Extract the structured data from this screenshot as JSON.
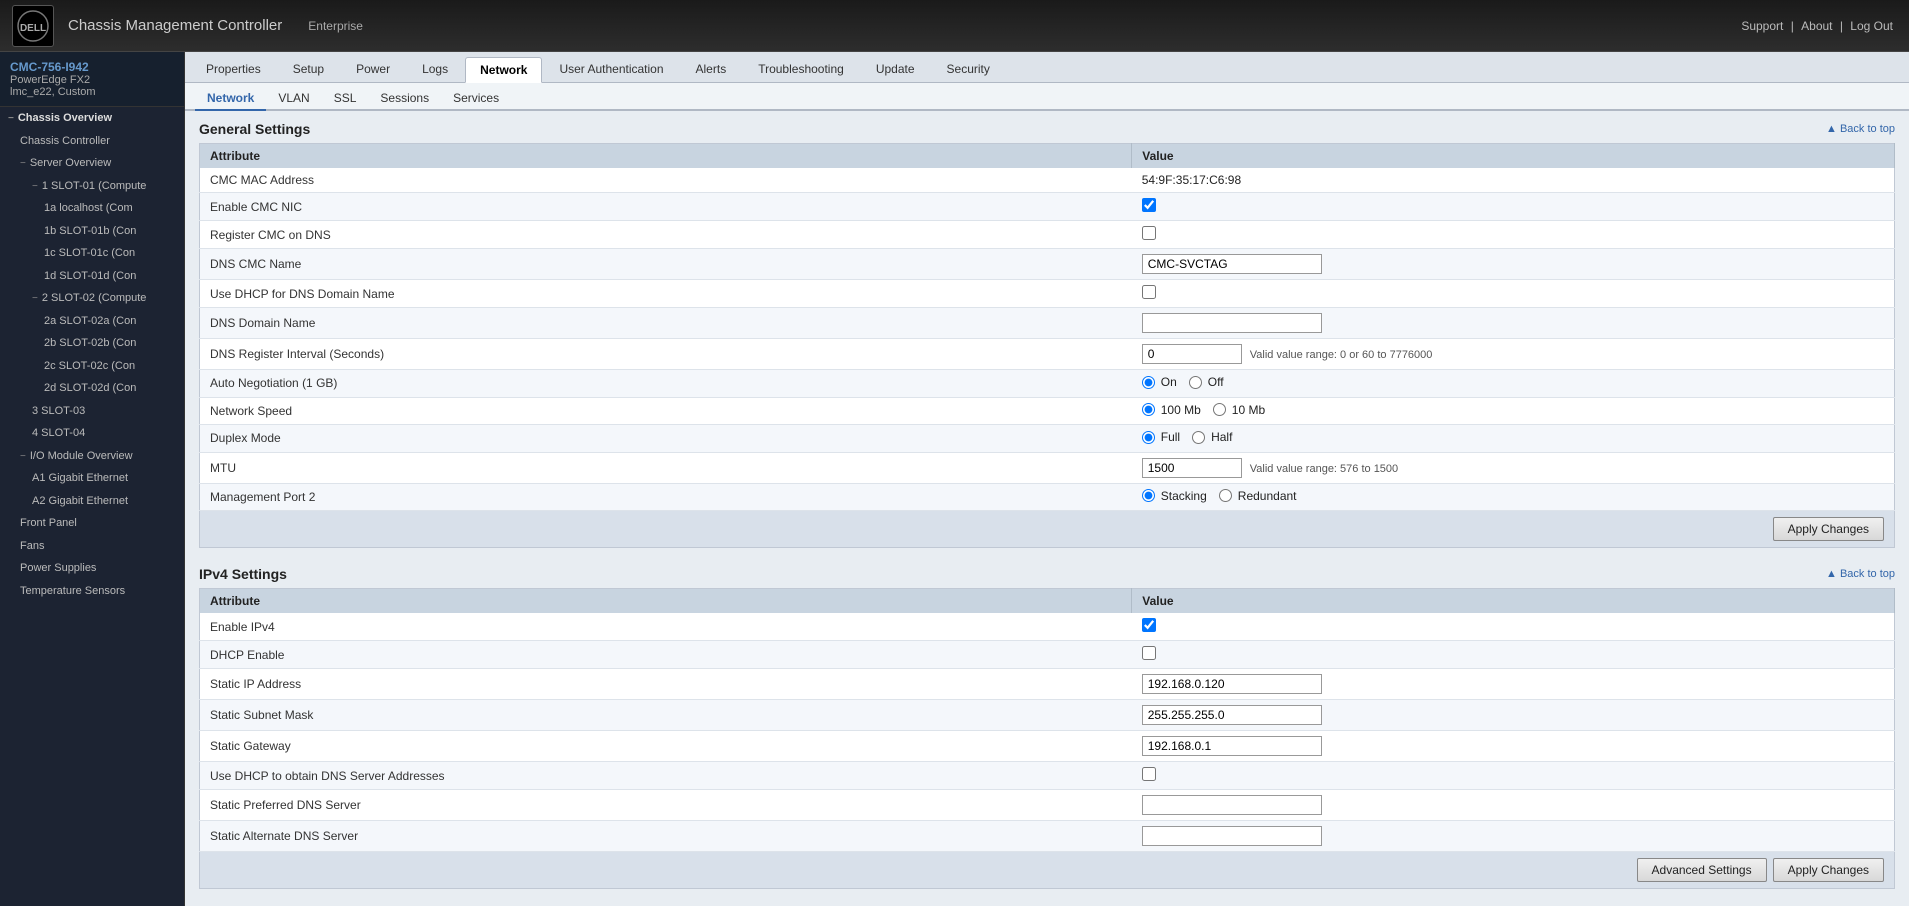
{
  "header": {
    "logo_text": "DELL",
    "title": "Chassis Management Controller",
    "badge": "Enterprise",
    "nav_support": "Support",
    "nav_about": "About",
    "nav_logout": "Log Out"
  },
  "sidebar": {
    "device_name": "CMC-756-I942",
    "device_model": "PowerEdge FX2",
    "device_custom": "lmc_e22, Custom",
    "items": [
      {
        "label": "Chassis Overview",
        "level": 0,
        "toggle": "−"
      },
      {
        "label": "Chassis Controller",
        "level": 1,
        "toggle": ""
      },
      {
        "label": "Server Overview",
        "level": 1,
        "toggle": "−"
      },
      {
        "label": "1  SLOT-01 (Compute",
        "level": 2,
        "toggle": "−"
      },
      {
        "label": "1a  localhost (Com",
        "level": 3,
        "toggle": ""
      },
      {
        "label": "1b  SLOT-01b (Con",
        "level": 3,
        "toggle": ""
      },
      {
        "label": "1c  SLOT-01c (Con",
        "level": 3,
        "toggle": ""
      },
      {
        "label": "1d  SLOT-01d (Con",
        "level": 3,
        "toggle": ""
      },
      {
        "label": "2  SLOT-02 (Compute",
        "level": 2,
        "toggle": "−"
      },
      {
        "label": "2a  SLOT-02a (Con",
        "level": 3,
        "toggle": ""
      },
      {
        "label": "2b  SLOT-02b (Con",
        "level": 3,
        "toggle": ""
      },
      {
        "label": "2c  SLOT-02c (Con",
        "level": 3,
        "toggle": ""
      },
      {
        "label": "2d  SLOT-02d (Con",
        "level": 3,
        "toggle": ""
      },
      {
        "label": "3  SLOT-03",
        "level": 2,
        "toggle": ""
      },
      {
        "label": "4  SLOT-04",
        "level": 2,
        "toggle": ""
      },
      {
        "label": "I/O Module Overview",
        "level": 1,
        "toggle": "−"
      },
      {
        "label": "A1  Gigabit Ethernet",
        "level": 2,
        "toggle": ""
      },
      {
        "label": "A2  Gigabit Ethernet",
        "level": 2,
        "toggle": ""
      },
      {
        "label": "Front Panel",
        "level": 1,
        "toggle": ""
      },
      {
        "label": "Fans",
        "level": 1,
        "toggle": ""
      },
      {
        "label": "Power Supplies",
        "level": 1,
        "toggle": ""
      },
      {
        "label": "Temperature Sensors",
        "level": 1,
        "toggle": ""
      }
    ]
  },
  "tabs": {
    "main": [
      "Properties",
      "Setup",
      "Power",
      "Logs",
      "Network",
      "User Authentication",
      "Alerts",
      "Troubleshooting",
      "Update",
      "Security"
    ],
    "active_main": "Network",
    "sub": [
      "Network",
      "VLAN",
      "SSL",
      "Sessions",
      "Services"
    ],
    "active_sub": "Network"
  },
  "general_settings": {
    "title": "General Settings",
    "back_to_top": "Back to top",
    "col_attribute": "Attribute",
    "col_value": "Value",
    "rows": [
      {
        "attribute": "CMC MAC Address",
        "type": "text_static",
        "value": "54:9F:35:17:C6:98"
      },
      {
        "attribute": "Enable CMC NIC",
        "type": "checkbox",
        "checked": true
      },
      {
        "attribute": "Register CMC on DNS",
        "type": "checkbox",
        "checked": false
      },
      {
        "attribute": "DNS CMC Name",
        "type": "text_input",
        "value": "CMC-SVCTAG"
      },
      {
        "attribute": "Use DHCP for DNS Domain Name",
        "type": "checkbox",
        "checked": false
      },
      {
        "attribute": "DNS Domain Name",
        "type": "text_input",
        "value": ""
      },
      {
        "attribute": "DNS Register Interval (Seconds)",
        "type": "text_input_range",
        "value": "0",
        "range": "Valid value range: 0 or 60 to 7776000"
      },
      {
        "attribute": "Auto Negotiation (1 GB)",
        "type": "radio",
        "options": [
          "On",
          "Off"
        ],
        "selected": "On"
      },
      {
        "attribute": "Network Speed",
        "type": "radio",
        "options": [
          "100 Mb",
          "10 Mb"
        ],
        "selected": "100 Mb"
      },
      {
        "attribute": "Duplex Mode",
        "type": "radio",
        "options": [
          "Full",
          "Half"
        ],
        "selected": "Full"
      },
      {
        "attribute": "MTU",
        "type": "text_input_range",
        "value": "1500",
        "range": "Valid value range: 576 to 1500"
      },
      {
        "attribute": "Management Port 2",
        "type": "radio",
        "options": [
          "Stacking",
          "Redundant"
        ],
        "selected": "Stacking"
      }
    ],
    "apply_label": "Apply Changes"
  },
  "ipv4_settings": {
    "title": "IPv4 Settings",
    "back_to_top": "Back to top",
    "col_attribute": "Attribute",
    "col_value": "Value",
    "rows": [
      {
        "attribute": "Enable IPv4",
        "type": "checkbox",
        "checked": true
      },
      {
        "attribute": "DHCP Enable",
        "type": "checkbox",
        "checked": false
      },
      {
        "attribute": "Static IP Address",
        "type": "text_input",
        "value": "192.168.0.120"
      },
      {
        "attribute": "Static Subnet Mask",
        "type": "text_input",
        "value": "255.255.255.0"
      },
      {
        "attribute": "Static Gateway",
        "type": "text_input",
        "value": "192.168.0.1"
      },
      {
        "attribute": "Use DHCP to obtain DNS Server Addresses",
        "type": "checkbox",
        "checked": false
      },
      {
        "attribute": "Static Preferred DNS Server",
        "type": "text_input",
        "value": ""
      },
      {
        "attribute": "Static Alternate DNS Server",
        "type": "text_input",
        "value": ""
      }
    ],
    "advanced_label": "Advanced Settings",
    "apply_label": "Apply Changes"
  }
}
